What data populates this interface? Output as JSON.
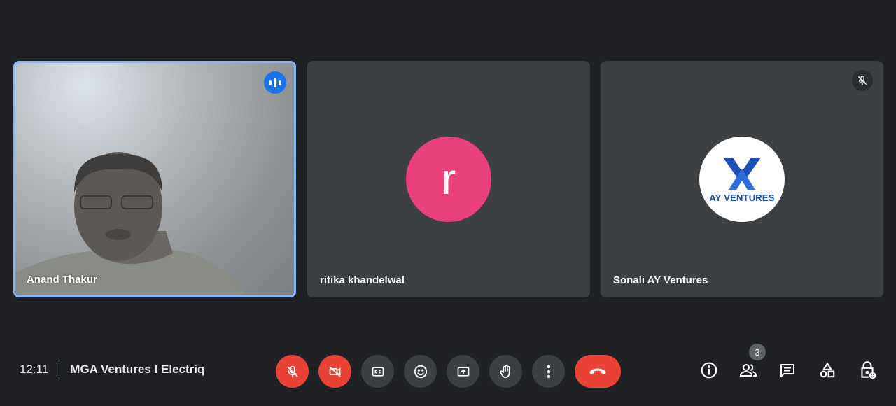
{
  "participants": [
    {
      "name": "Anand Thakur",
      "status": "speaking"
    },
    {
      "name": "ritika khandelwal",
      "avatar_letter": "r",
      "avatar_color": "#e8417b"
    },
    {
      "name": "Sonali AY Ventures",
      "avatar_logo_text": "AY VENTURES",
      "status": "muted"
    }
  ],
  "footer": {
    "time": "12:11",
    "meeting_title": "MGA Ventures I Electriq",
    "people_count": "3"
  },
  "controls": [
    "mic-off-icon",
    "camera-off-icon",
    "captions-icon",
    "emoji-icon",
    "present-screen-icon",
    "raise-hand-icon",
    "more-options-icon",
    "leave-call-icon"
  ],
  "right_controls": [
    "info-icon",
    "people-icon",
    "chat-icon",
    "activities-icon",
    "host-controls-icon"
  ],
  "colors": {
    "accent": "#8ab4f8",
    "danger": "#ea4335",
    "background": "#202124",
    "tile": "#3c4043"
  }
}
